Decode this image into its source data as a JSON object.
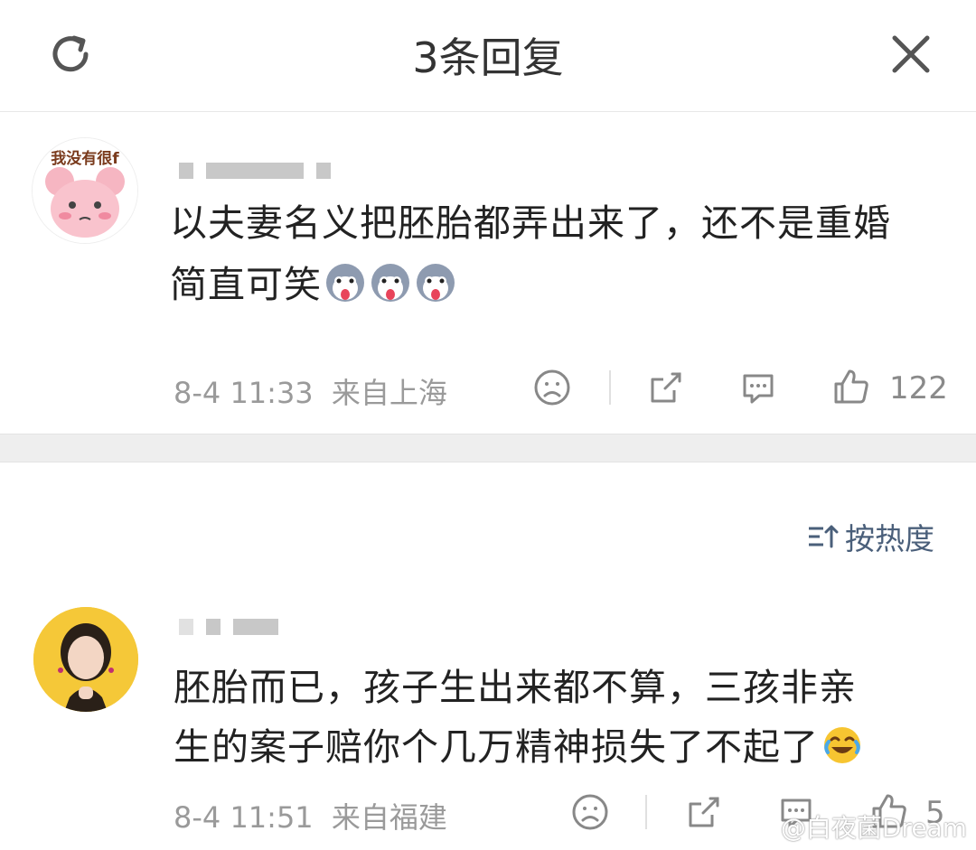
{
  "header": {
    "title": "3条回复"
  },
  "root_comment": {
    "avatar_text": "我没有很f",
    "text_line1": "以夫妻名义把胚胎都弄出来了，还不是重婚",
    "text_line2": "简直可笑",
    "time": "8-4 11:33",
    "location": "来自上海",
    "likes": "122"
  },
  "sort": {
    "label": "按热度"
  },
  "replies": [
    {
      "text_line1": "胚胎而已，孩子生出来都不算，三孩非亲",
      "text_line2": "生的案子赔你个几万精神损失了不起了",
      "time": "8-4 11:51",
      "location": "来自福建",
      "likes": "5"
    }
  ],
  "watermark": "@白夜菌Dream"
}
